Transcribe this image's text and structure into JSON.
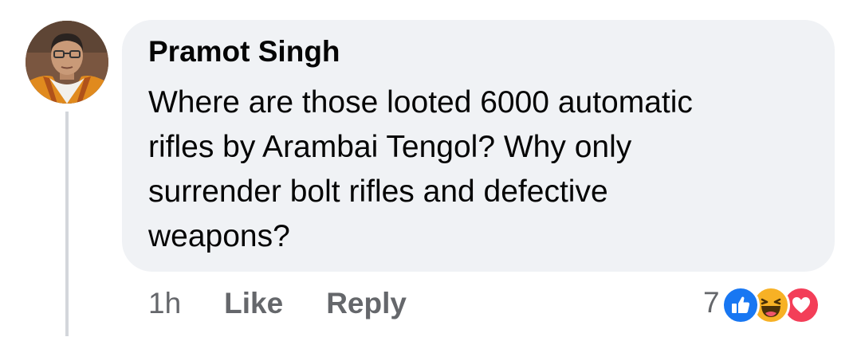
{
  "comment": {
    "author": "Pramot Singh",
    "text_lines": [
      "Where are those looted 6000 automatic",
      "rifles by Arambai Tengol? Why only",
      "surrender bolt rifles and defective",
      "weapons?"
    ],
    "time": "1h",
    "like_label": "Like",
    "reply_label": "Reply",
    "reaction_count": "7",
    "reactions": [
      "like-icon",
      "haha-icon",
      "love-icon"
    ]
  },
  "colors": {
    "bubble": "#f0f2f5",
    "text": "#050505",
    "muted": "#65676b",
    "like_blue": "#1877f2",
    "haha_yellow": "#f7b125",
    "love_red": "#f33e58"
  }
}
